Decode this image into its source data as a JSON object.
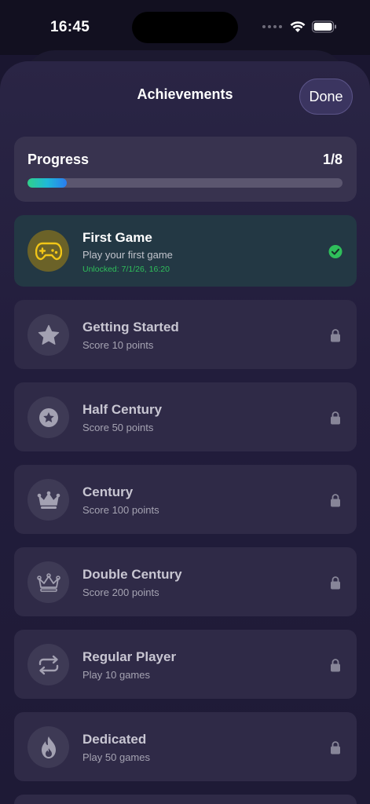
{
  "status": {
    "time": "16:45"
  },
  "header": {
    "title": "Achievements",
    "done_label": "Done"
  },
  "progress": {
    "label": "Progress",
    "count": "1/8",
    "fraction": 0.125
  },
  "achievements": [
    {
      "title": "First Game",
      "description": "Play your first game",
      "unlocked_text": "Unlocked: 7/1/26, 16:20",
      "icon": "gamepad-icon",
      "state": "unlocked"
    },
    {
      "title": "Getting Started",
      "description": "Score 10 points",
      "icon": "star-icon",
      "state": "locked"
    },
    {
      "title": "Half Century",
      "description": "Score 50 points",
      "icon": "star-circle-icon",
      "state": "locked"
    },
    {
      "title": "Century",
      "description": "Score 100 points",
      "icon": "crown-icon",
      "state": "locked"
    },
    {
      "title": "Double Century",
      "description": "Score 200 points",
      "icon": "crown-outline-icon",
      "state": "locked"
    },
    {
      "title": "Regular Player",
      "description": "Play 10 games",
      "icon": "repeat-icon",
      "state": "locked"
    },
    {
      "title": "Dedicated",
      "description": "Play 50 games",
      "icon": "flame-icon",
      "state": "locked"
    }
  ],
  "colors": {
    "accent_unlocked": "#2fbf5b",
    "gamepad_yellow": "#f2c617",
    "locked_icon": "#9a98a8"
  }
}
